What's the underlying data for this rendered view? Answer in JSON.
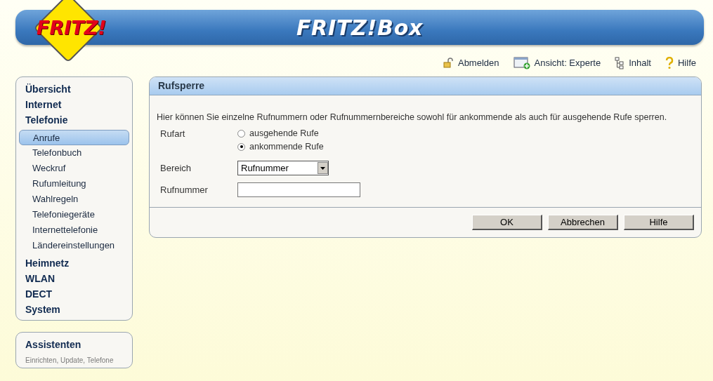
{
  "header": {
    "logo": "FRITZ!",
    "title": "FRITZ!Box"
  },
  "top_links": [
    {
      "kind": "logout",
      "label": "Abmelden"
    },
    {
      "kind": "view",
      "label": "Ansicht: Experte"
    },
    {
      "kind": "content",
      "label": "Inhalt"
    },
    {
      "kind": "help",
      "label": "Hilfe"
    }
  ],
  "sidebar": {
    "items": [
      {
        "label": "Übersicht"
      },
      {
        "label": "Internet"
      },
      {
        "label": "Telefonie",
        "children": [
          {
            "label": "Anrufe",
            "selected": true
          },
          {
            "label": "Telefonbuch",
            "selected": false
          },
          {
            "label": "Weckruf",
            "selected": false
          },
          {
            "label": "Rufumleitung",
            "selected": false
          },
          {
            "label": "Wahlregeln",
            "selected": false
          },
          {
            "label": "Telefoniegeräte",
            "selected": false
          },
          {
            "label": "Internettelefonie",
            "selected": false
          },
          {
            "label": "Ländereinstellungen",
            "selected": false
          }
        ]
      },
      {
        "label": "Heimnetz"
      },
      {
        "label": "WLAN"
      },
      {
        "label": "DECT"
      },
      {
        "label": "System"
      }
    ]
  },
  "assistants": {
    "title": "Assistenten",
    "subtitle": "Einrichten, Update, Telefone"
  },
  "panel": {
    "title": "Rufsperre",
    "intro": "Hier können Sie einzelne Rufnummern oder Rufnummernbereiche sowohl für ankommende als auch für ausgehende Rufe sperren.",
    "call_type": {
      "label": "Rufart",
      "options": [
        {
          "label": "ausgehende Rufe",
          "selected": false
        },
        {
          "label": "ankommende Rufe",
          "selected": true
        }
      ]
    },
    "range": {
      "label": "Bereich",
      "value": "Rufnummer"
    },
    "number": {
      "label": "Rufnummer"
    },
    "buttons": [
      "OK",
      "Abbrechen",
      "Hilfe"
    ]
  }
}
